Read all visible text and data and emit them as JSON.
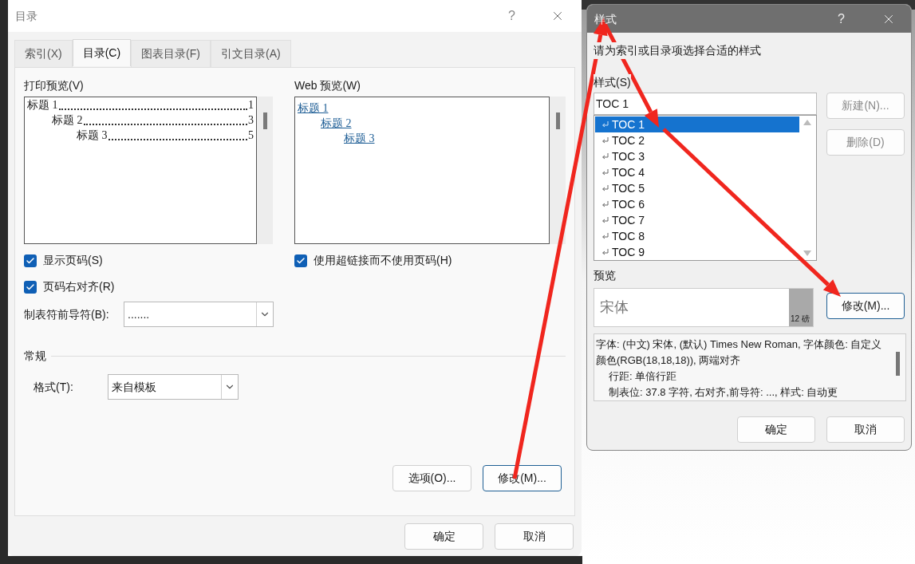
{
  "toc_dialog": {
    "title": "目录",
    "help": "?",
    "tabs": [
      {
        "label": "索引(X)",
        "selected": false
      },
      {
        "label": "目录(C)",
        "selected": true
      },
      {
        "label": "图表目录(F)",
        "selected": false
      },
      {
        "label": "引文目录(A)",
        "selected": false
      }
    ],
    "print_preview": {
      "label": "打印预览(V)",
      "entries": [
        {
          "text": "标题 1",
          "page": "1",
          "children": [
            {
              "text": "标题 2",
              "page": "3",
              "children": [
                {
                  "text": "标题 3",
                  "page": "5"
                }
              ]
            }
          ]
        }
      ]
    },
    "web_preview": {
      "label": "Web 预览(W)",
      "entries": [
        {
          "text": "标题 1",
          "children": [
            {
              "text": "标题 2",
              "children": [
                {
                  "text": "标题 3"
                }
              ]
            }
          ]
        }
      ]
    },
    "left_checkboxes": [
      {
        "label": "显示页码(S)",
        "checked": true
      },
      {
        "label": "页码右对齐(R)",
        "checked": true
      }
    ],
    "right_checkboxes": [
      {
        "label": "使用超链接而不使用页码(H)",
        "checked": true
      }
    ],
    "tab_leader": {
      "label": "制表符前导符(B):",
      "value": "......."
    },
    "general": {
      "heading": "常规",
      "format_label": "格式(T):",
      "format_value": "来自模板"
    },
    "panel_buttons": [
      {
        "label": "选项(O)...",
        "focused": false
      },
      {
        "label": "修改(M)...",
        "focused": true
      }
    ],
    "buttons": [
      "确定",
      "取消"
    ]
  },
  "style_dialog": {
    "title": "样式",
    "help": "?",
    "instruction": "请为索引或目录项选择合适的样式",
    "style_label": "样式(S)",
    "style_value": "TOC 1",
    "styles": [
      {
        "name": "TOC 1",
        "selected": true
      },
      {
        "name": "TOC 2",
        "selected": false
      },
      {
        "name": "TOC 3",
        "selected": false
      },
      {
        "name": "TOC 4",
        "selected": false
      },
      {
        "name": "TOC 5",
        "selected": false
      },
      {
        "name": "TOC 6",
        "selected": false
      },
      {
        "name": "TOC 7",
        "selected": false
      },
      {
        "name": "TOC 8",
        "selected": false
      },
      {
        "name": "TOC 9",
        "selected": false
      }
    ],
    "side_buttons": [
      {
        "label": "新建(N)...",
        "disabled": true
      },
      {
        "label": "删除(D)",
        "disabled": true
      }
    ],
    "preview_label": "预览",
    "preview_text": "宋体",
    "preview_size": "12 磅",
    "modify_button": "修改(M)...",
    "description": [
      {
        "kind": "para",
        "text": "字体: (中文) 宋体, (默认) Times New Roman, 字体颜色: 自定义颜色(RGB(18,18,18)), 两端对齐"
      },
      {
        "kind": "indented",
        "text": "行距: 单倍行距"
      },
      {
        "kind": "indented",
        "text": "制表位:  37.8 字符, 右对齐,前导符: ..., 样式: 自动更"
      }
    ],
    "buttons": [
      "确定",
      "取消"
    ]
  }
}
